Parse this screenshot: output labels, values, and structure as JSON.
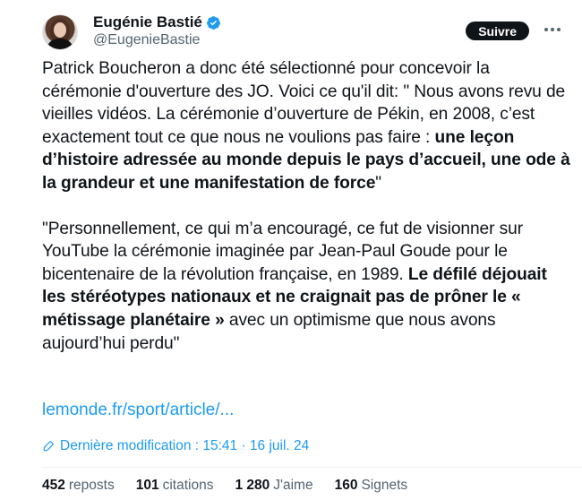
{
  "author": {
    "name": "Eugénie Bastié",
    "handle": "@EugenieBastie"
  },
  "follow_label": "Suivre",
  "tweet": {
    "p1_a": "Patrick Boucheron a donc été sélectionné pour concevoir la cérémonie d'ouverture des JO. Voici ce qu'il dit: \" Nous avons revu de vieilles vidéos. La cérémonie  d’ouverture de Pékin, en 2008, c’est exactement tout ce que nous ne  voulions pas faire : ",
    "p1_b": "une leçon d’histoire adressée au monde depuis le pays d’accueil, une ode à la grandeur et une manifestation de force",
    "p1_c": "\"",
    "p2_a": "\"Personnellement, ce qui m’a encouragé, ce fut de visionner sur YouTube  la cérémonie imaginée par Jean-Paul Goude pour le bicentenaire de la  révolution française, en 1989. ",
    "p2_b": "Le défilé déjouait les stéréotypes  nationaux et ne craignait pas de prôner le « métissage planétaire »",
    "p2_c": " avec  un optimisme que nous avons aujourd’hui perdu\""
  },
  "link": "lemonde.fr/sport/article/...",
  "edit": "Dernière modification : 15:41 · 16 juil. 24",
  "stats": {
    "reposts_num": "452",
    "reposts_lbl": "reposts",
    "quotes_num": "101",
    "quotes_lbl": "citations",
    "likes_num": "1 280",
    "likes_lbl": "J'aime",
    "bookmarks_num": "160",
    "bookmarks_lbl": "Signets"
  },
  "colors": {
    "accent": "#1d9bf0",
    "text": "#0f1419",
    "muted": "#536471"
  },
  "icons": [
    "verified-badge-icon",
    "more-options-icon",
    "pencil-edit-icon"
  ]
}
